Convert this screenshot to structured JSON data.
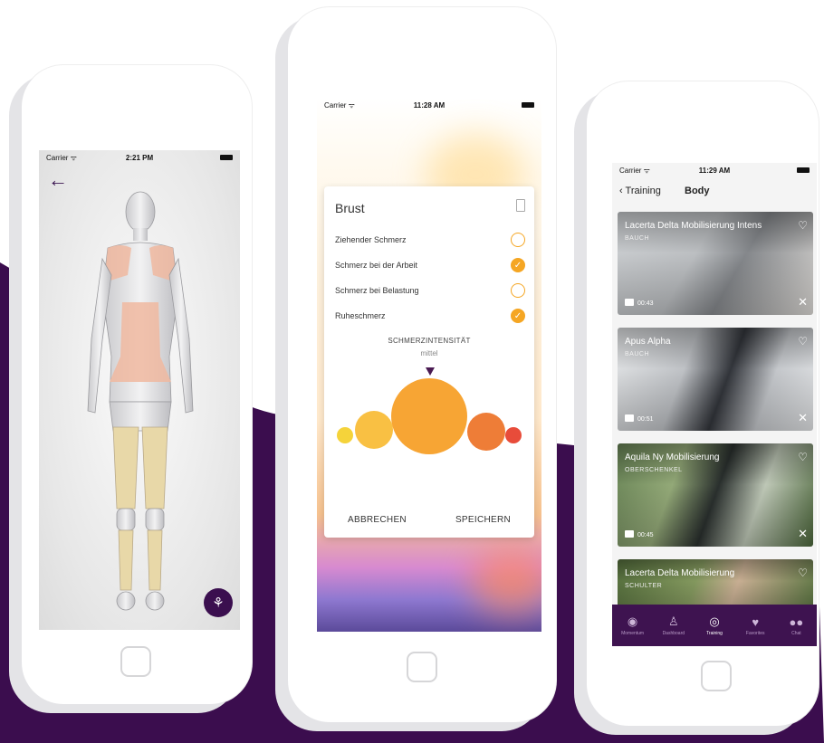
{
  "colors": {
    "brand_purple": "#3b0f4f",
    "accent_orange": "#f5a623",
    "pain_marker": "#f0b8a0",
    "leg_marker": "#e8d8a8"
  },
  "phone1": {
    "status": {
      "carrier": "Carrier ᯤ",
      "time": "2:21 PM"
    },
    "back_icon": "arrow-left-icon",
    "fab_icon": "body-pose-icon"
  },
  "phone2": {
    "status": {
      "carrier": "Carrier ᯤ",
      "time": "11:28 AM"
    },
    "card": {
      "title": "Brust",
      "options": [
        {
          "label": "Ziehender Schmerz",
          "checked": false
        },
        {
          "label": "Schmerz bei der Arbeit",
          "checked": true
        },
        {
          "label": "Schmerz bei Belastung",
          "checked": false
        },
        {
          "label": "Ruheschmerz",
          "checked": true
        }
      ],
      "intensity_title": "SCHMERZINTENSITÄT",
      "intensity_value": "mittel",
      "cancel": "ABBRECHEN",
      "save": "SPEICHERN"
    }
  },
  "phone3": {
    "status": {
      "carrier": "Carrier ᯤ",
      "time": "11:29 AM"
    },
    "nav": {
      "back": "Training",
      "title": "Body"
    },
    "videos": [
      {
        "title": "Lacerta Delta Mobilisierung Intens",
        "subtitle": "BAUCH",
        "duration": "00:43"
      },
      {
        "title": "Apus Alpha",
        "subtitle": "BAUCH",
        "duration": "00:51"
      },
      {
        "title": "Aquila Ny Mobilisierung",
        "subtitle": "OBERSCHENKEL",
        "duration": "00:45"
      },
      {
        "title": "Lacerta Delta Mobilisierung",
        "subtitle": "SCHULTER",
        "duration": ""
      }
    ],
    "tabs": [
      {
        "label": "Momentum",
        "icon": "target-icon"
      },
      {
        "label": "Dashboard",
        "icon": "figure-icon"
      },
      {
        "label": "Training",
        "icon": "training-icon",
        "active": true
      },
      {
        "label": "Favorites",
        "icon": "heart-icon"
      },
      {
        "label": "Chat",
        "icon": "chat-icon"
      }
    ]
  }
}
